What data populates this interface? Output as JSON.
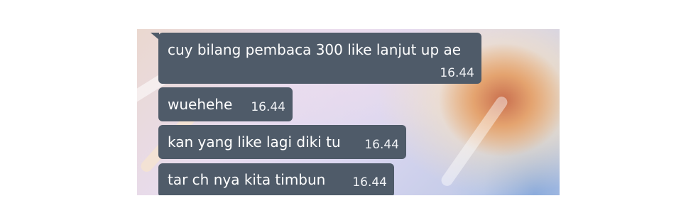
{
  "messages": [
    {
      "text": "cuy bilang pembaca 300 like lanjut up ae",
      "time": "16.44"
    },
    {
      "text": "wuehehe",
      "time": "16.44"
    },
    {
      "text": "kan yang like lagi diki tu",
      "time": "16.44"
    },
    {
      "text": "tar ch nya kita timbun",
      "time": "16.44"
    }
  ],
  "colors": {
    "bubble": "#4f5b69",
    "text": "#ffffff",
    "page_background": "#ffffff"
  }
}
